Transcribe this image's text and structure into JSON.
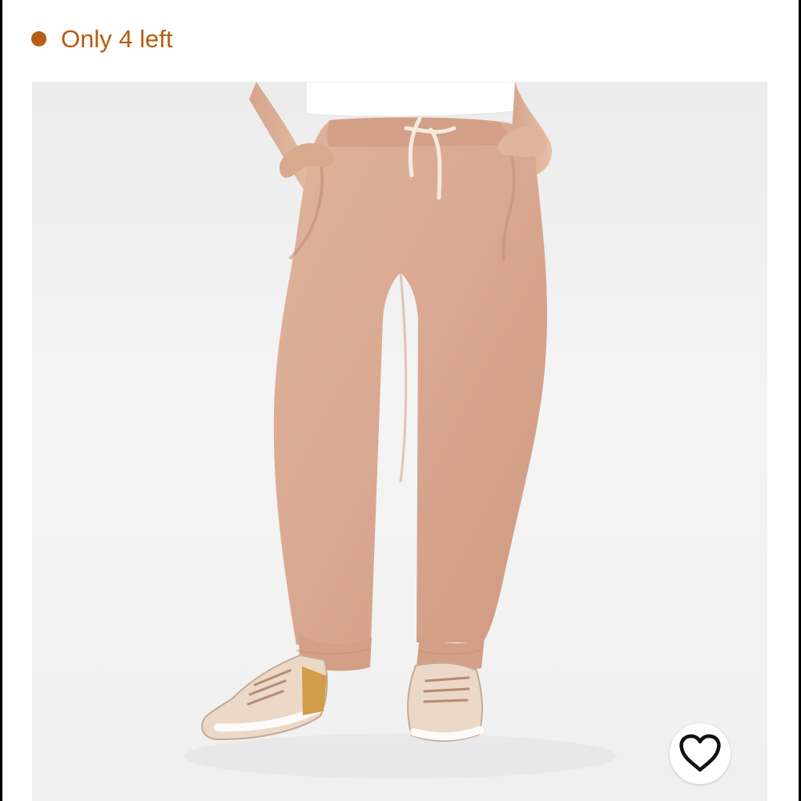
{
  "stock": {
    "text": "Only 4 left",
    "color": "#b65d12"
  },
  "product": {
    "image_icon": "jogger-pants-product-image"
  },
  "favorite": {
    "icon": "heart-icon"
  },
  "colors": {
    "background": "#ffffff",
    "image_background": "#f1f1f1",
    "pants": "#d8a98f",
    "shoe_accent": "#d39c4a"
  }
}
